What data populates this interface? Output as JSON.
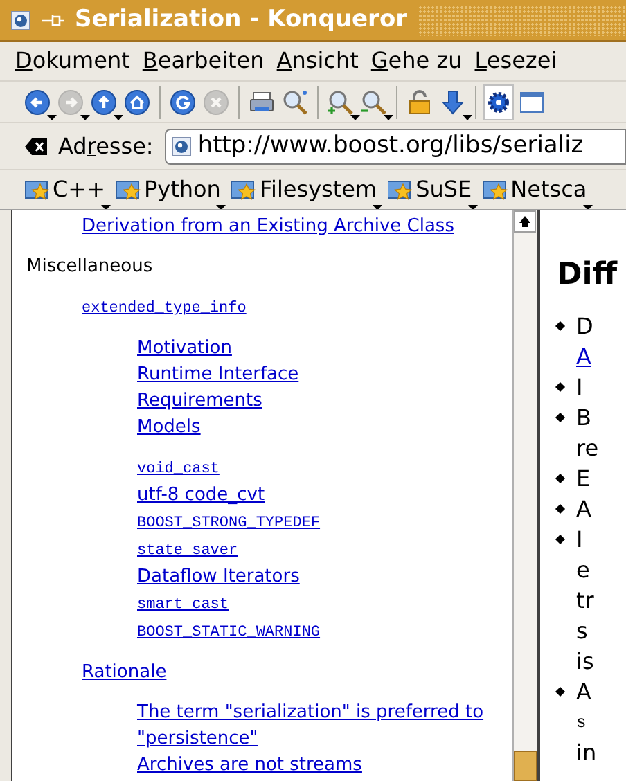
{
  "window": {
    "title": "Serialization - Konqueror"
  },
  "menu": [
    {
      "label": "Dokument"
    },
    {
      "label": "Bearbeiten"
    },
    {
      "label": "Ansicht"
    },
    {
      "label": "Gehe zu"
    },
    {
      "label": "Lesezei"
    }
  ],
  "toolbar": [
    {
      "kind": "back",
      "disabled": false,
      "dropdown": true
    },
    {
      "kind": "forward",
      "disabled": true,
      "dropdown": true
    },
    {
      "kind": "up",
      "disabled": false,
      "dropdown": true
    },
    {
      "kind": "home",
      "disabled": false,
      "dropdown": false
    },
    {
      "kind": "sep"
    },
    {
      "kind": "reload",
      "disabled": false,
      "dropdown": false
    },
    {
      "kind": "stop",
      "disabled": true,
      "dropdown": false
    },
    {
      "kind": "sep"
    },
    {
      "kind": "print",
      "disabled": false,
      "dropdown": false
    },
    {
      "kind": "find",
      "disabled": false,
      "dropdown": false
    },
    {
      "kind": "sep"
    },
    {
      "kind": "zoomin",
      "disabled": false,
      "dropdown": true
    },
    {
      "kind": "zoomout",
      "disabled": false,
      "dropdown": true
    },
    {
      "kind": "sep"
    },
    {
      "kind": "lock",
      "disabled": false,
      "dropdown": false
    },
    {
      "kind": "download",
      "disabled": false,
      "dropdown": true
    },
    {
      "kind": "sep"
    },
    {
      "kind": "gear",
      "disabled": false,
      "dropdown": false
    },
    {
      "kind": "window",
      "disabled": false,
      "dropdown": false
    }
  ],
  "address": {
    "label_pre": "Ad",
    "label_accel": "r",
    "label_post": "esse:",
    "value": "http://www.boost.org/libs/serializ"
  },
  "bookmarks": [
    {
      "label": "C++"
    },
    {
      "label": "Python"
    },
    {
      "label": "Filesystem"
    },
    {
      "label": "SuSE"
    },
    {
      "label": "Netsca"
    }
  ],
  "left_pane": {
    "items": [
      {
        "kind": "group",
        "children": [
          {
            "kind": "link",
            "text": "Derivation from an Existing Archive Class"
          }
        ]
      },
      {
        "kind": "heading",
        "text": "Miscellaneous",
        "children": [
          {
            "kind": "code",
            "text": "extended_type_info",
            "children": [
              {
                "kind": "link",
                "text": "Motivation"
              },
              {
                "kind": "link",
                "text": "Runtime Interface"
              },
              {
                "kind": "link",
                "text": "Requirements"
              },
              {
                "kind": "link",
                "text": "Models"
              }
            ]
          },
          {
            "kind": "group",
            "children": [
              {
                "kind": "code",
                "text": "void_cast"
              },
              {
                "kind": "link",
                "text": "utf-8 code_cvt"
              },
              {
                "kind": "code",
                "text": "BOOST_STRONG_TYPEDEF"
              },
              {
                "kind": "code",
                "text": "state_saver"
              },
              {
                "kind": "link",
                "text": "Dataflow Iterators"
              },
              {
                "kind": "code",
                "text": "smart_cast"
              },
              {
                "kind": "code",
                "text": "BOOST_STATIC_WARNING"
              }
            ]
          },
          {
            "kind": "link",
            "text": "Rationale",
            "children": [
              {
                "kind": "link",
                "text": "The term \"serialization\" is preferred to \"persistence\""
              },
              {
                "kind": "link",
                "text": "Archives are not streams"
              }
            ]
          }
        ]
      }
    ]
  },
  "right_pane": {
    "heading": "Diff",
    "items": [
      {
        "lines": [
          {
            "kind": "text",
            "text": "D"
          },
          {
            "kind": "link",
            "text": "A"
          }
        ]
      },
      {
        "lines": [
          {
            "kind": "text",
            "text": "I"
          }
        ]
      },
      {
        "lines": [
          {
            "kind": "text",
            "text": "B"
          },
          {
            "kind": "text",
            "text": "re"
          }
        ]
      },
      {
        "lines": [
          {
            "kind": "text",
            "text": "E"
          }
        ]
      },
      {
        "lines": [
          {
            "kind": "text",
            "text": "A"
          }
        ]
      },
      {
        "lines": [
          {
            "kind": "text",
            "text": "I"
          },
          {
            "kind": "text",
            "text": "e"
          },
          {
            "kind": "text",
            "text": "tr"
          },
          {
            "kind": "text",
            "text": "s"
          },
          {
            "kind": "text",
            "text": "is"
          }
        ]
      },
      {
        "lines": [
          {
            "kind": "text",
            "text": "A"
          },
          {
            "kind": "code",
            "text": "s"
          },
          {
            "kind": "text",
            "text": "in"
          }
        ]
      }
    ]
  }
}
